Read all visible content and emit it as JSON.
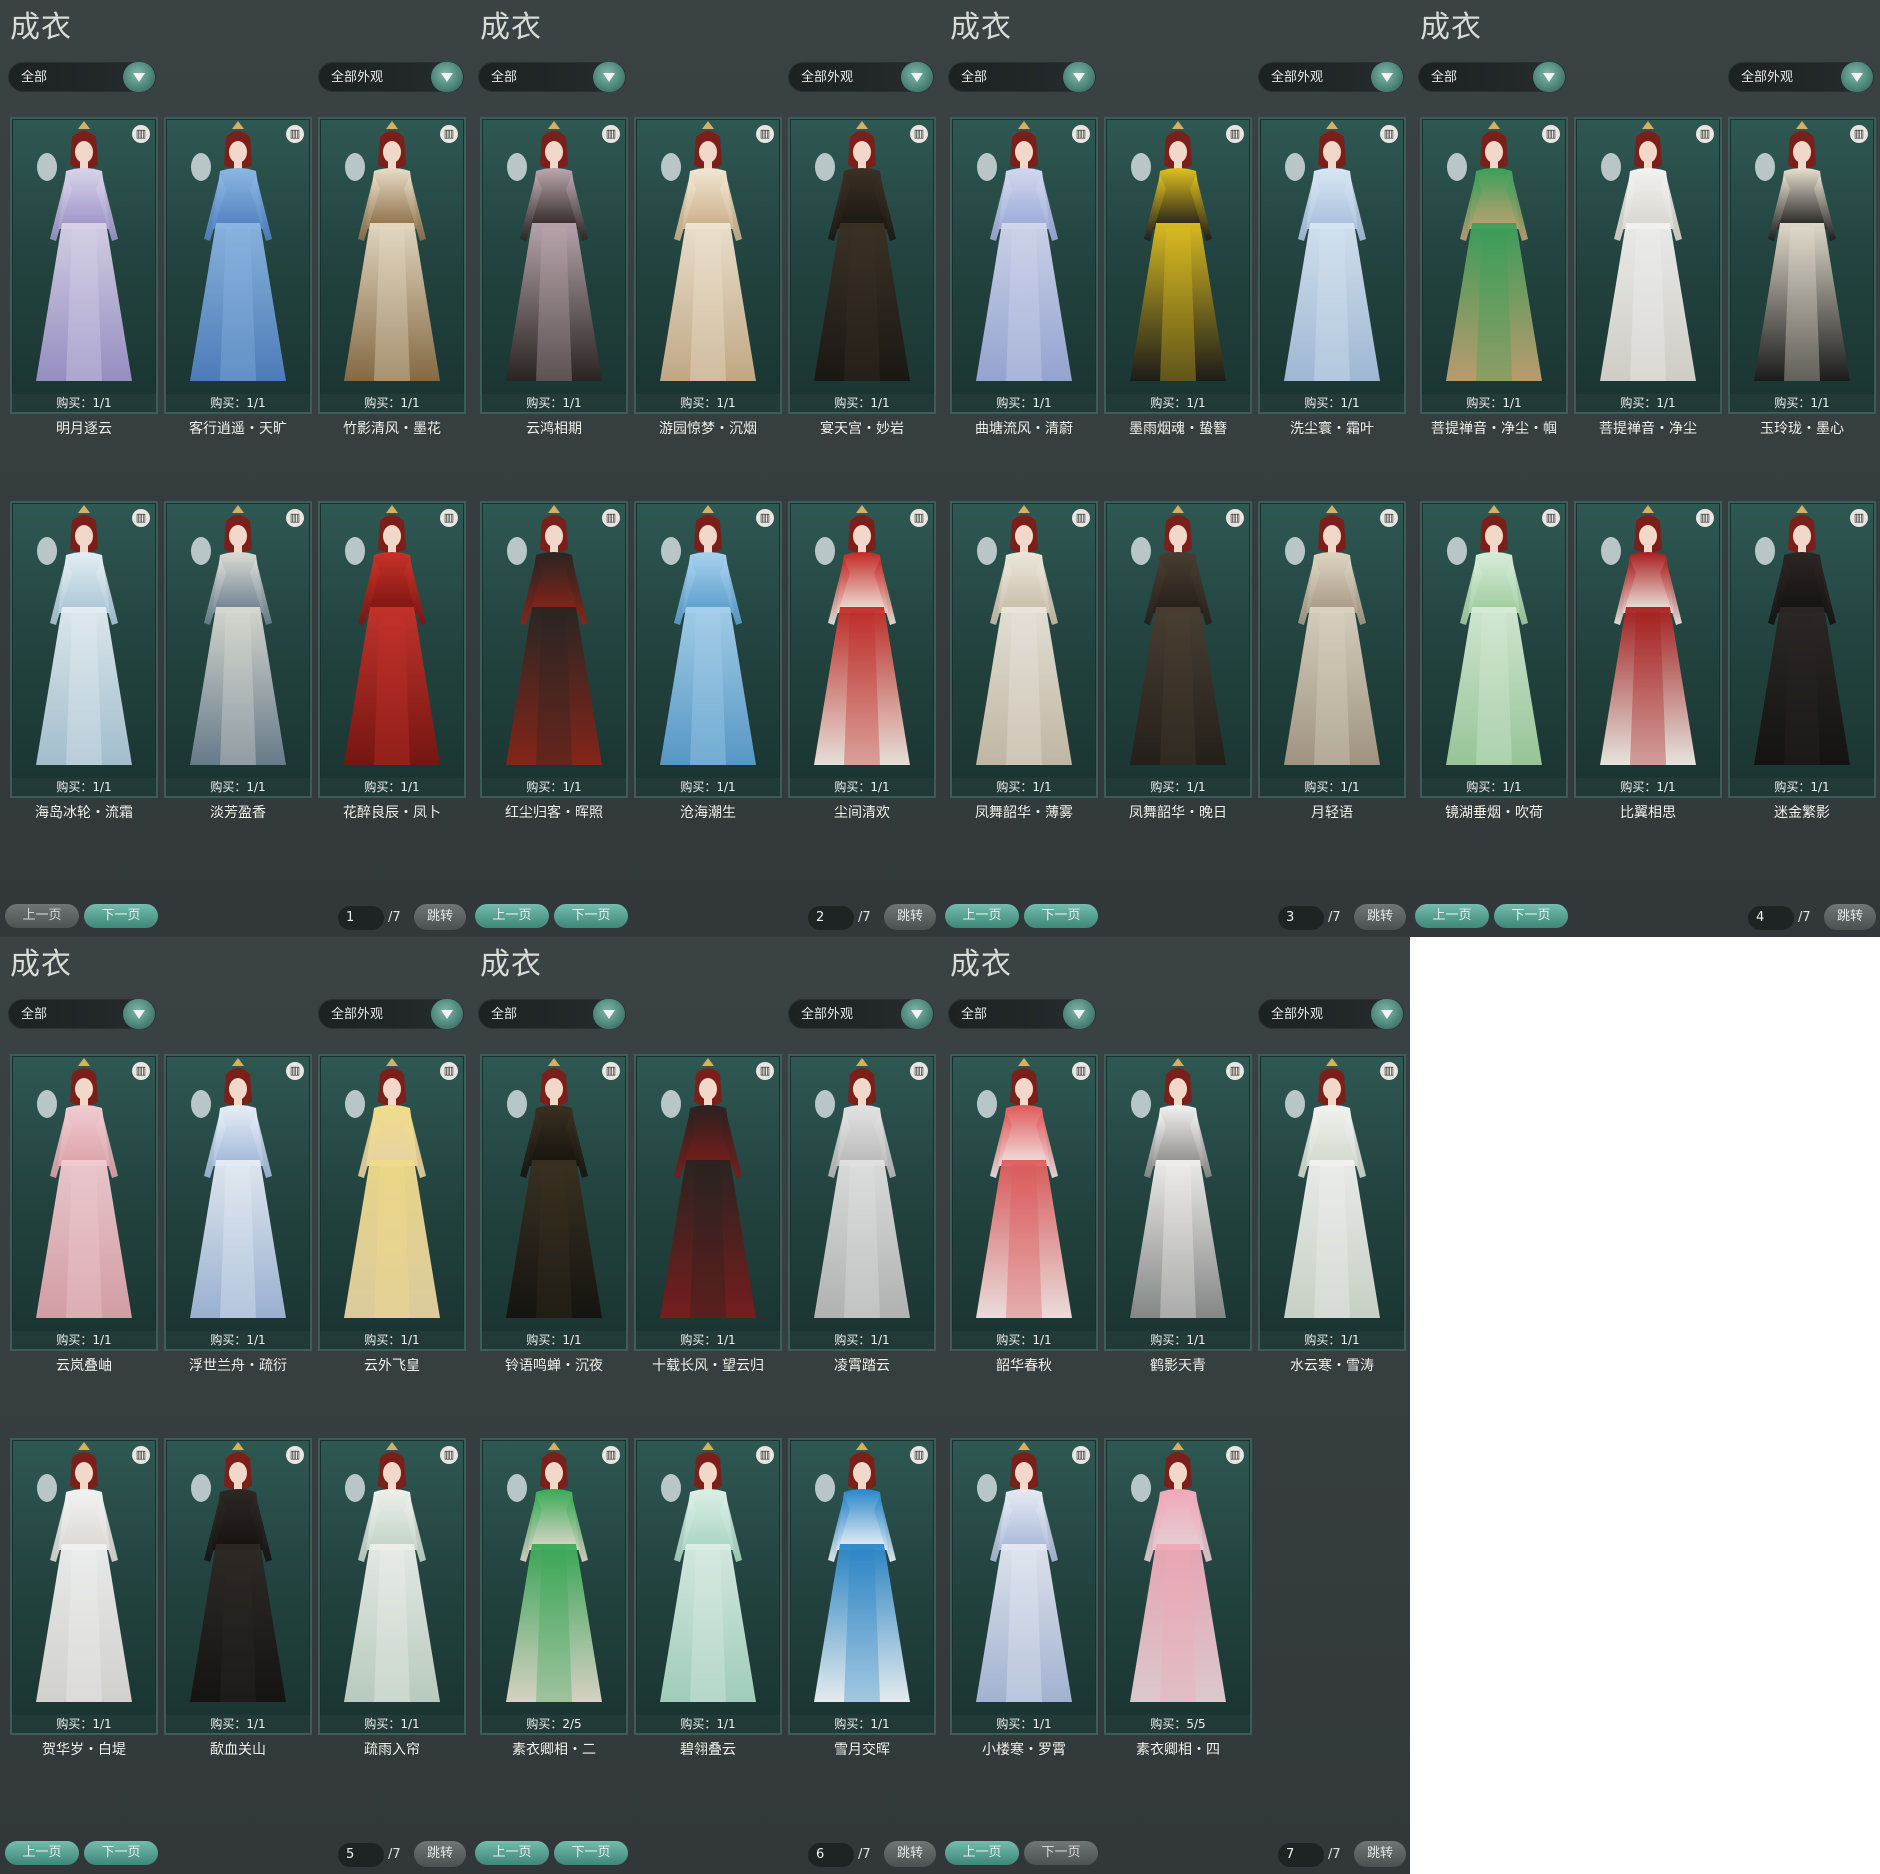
{
  "panels": [
    {
      "title": "成衣",
      "filter1": "全部",
      "filter2": "全部外观",
      "page": "1",
      "total": "/7",
      "prev": "上一页",
      "next": "下一页",
      "jump": "跳转",
      "prev_on": false,
      "next_on": true,
      "items": [
        {
          "buy": "购买：1/1",
          "name": "明月逐云",
          "palette": [
            "#d9d4ea",
            "#9c92c8"
          ]
        },
        {
          "buy": "购买：1/1",
          "name": "客行逍遥・天旷",
          "palette": [
            "#8db7e3",
            "#4f7fbf"
          ]
        },
        {
          "buy": "购买：1/1",
          "name": "竹影清风・墨花",
          "palette": [
            "#e8dcc6",
            "#8a6c44"
          ]
        },
        {
          "buy": "购买：1/1",
          "name": "海岛冰轮・流霜",
          "palette": [
            "#e4eef4",
            "#a9c4d4"
          ]
        },
        {
          "buy": "购买：1/1",
          "name": "淡芳盈香",
          "palette": [
            "#dcdcd4",
            "#6a7e8e"
          ]
        },
        {
          "buy": "购买：1/1",
          "name": "花醉良辰・凤卜",
          "palette": [
            "#c8322a",
            "#7a1410"
          ]
        }
      ]
    },
    {
      "title": "成衣",
      "filter1": "全部",
      "filter2": "全部外观",
      "page": "2",
      "total": "/7",
      "prev": "上一页",
      "next": "下一页",
      "jump": "跳转",
      "prev_on": true,
      "next_on": true,
      "items": [
        {
          "buy": "购买：1/1",
          "name": "云鸿相期",
          "palette": [
            "#bca8b0",
            "#2a2320"
          ]
        },
        {
          "buy": "购买：1/1",
          "name": "游园惊梦・沉烟",
          "palette": [
            "#f2e6d2",
            "#c9ad88"
          ]
        },
        {
          "buy": "购买：1/1",
          "name": "宴天宫・妙岩",
          "palette": [
            "#3c3024",
            "#1a1612"
          ]
        },
        {
          "buy": "购买：1/1",
          "name": "红尘归客・晖照",
          "palette": [
            "#2a2422",
            "#8a2418"
          ]
        },
        {
          "buy": "购买：1/1",
          "name": "沧海潮生",
          "palette": [
            "#a8d2ee",
            "#5a9ccc"
          ]
        },
        {
          "buy": "购买：1/1",
          "name": "尘间清欢",
          "palette": [
            "#c42a26",
            "#f0e8e0"
          ]
        }
      ]
    },
    {
      "title": "成衣",
      "filter1": "全部",
      "filter2": "全部外观",
      "page": "3",
      "total": "/7",
      "prev": "上一页",
      "next": "下一页",
      "jump": "跳转",
      "prev_on": true,
      "next_on": true,
      "items": [
        {
          "buy": "购买：1/1",
          "name": "曲塘流风・清蔚",
          "palette": [
            "#d2d8ee",
            "#9aa8d8"
          ]
        },
        {
          "buy": "购买：1/1",
          "name": "墨雨烟魂・蛰簪",
          "palette": [
            "#e0c020",
            "#1c1a18"
          ]
        },
        {
          "buy": "购买：1/1",
          "name": "洗尘寰・霜叶",
          "palette": [
            "#d8e6f4",
            "#a6bedc"
          ]
        },
        {
          "buy": "购买：1/1",
          "name": "凤舞韶华・薄雾",
          "palette": [
            "#ece6dc",
            "#c8bca8"
          ]
        },
        {
          "buy": "购买：1/1",
          "name": "凤舞韶华・晚日",
          "palette": [
            "#4a3e32",
            "#241e18"
          ]
        },
        {
          "buy": "购买：1/1",
          "name": "月轻语",
          "palette": [
            "#ddd4c2",
            "#a69884"
          ]
        }
      ]
    },
    {
      "title": "成衣",
      "filter1": "全部",
      "filter2": "全部外观",
      "page": "4",
      "total": "/7",
      "prev": "上一页",
      "next": "下一页",
      "jump": "跳转",
      "prev_on": true,
      "next_on": true,
      "items": [
        {
          "buy": "购买：1/1",
          "name": "菩提禅音・净尘・帼",
          "palette": [
            "#3aa05a",
            "#c2a070"
          ]
        },
        {
          "buy": "购买：1/1",
          "name": "菩提禅音・净尘",
          "palette": [
            "#f2f2f0",
            "#d8d4cc"
          ]
        },
        {
          "buy": "购买：1/1",
          "name": "玉玲珑・墨心",
          "palette": [
            "#e8e0d0",
            "#1a1a1a"
          ]
        },
        {
          "buy": "购买：1/1",
          "name": "镜湖垂烟・吹荷",
          "palette": [
            "#d8ecd8",
            "#9ccc9c"
          ]
        },
        {
          "buy": "购买：1/1",
          "name": "比翼相思",
          "palette": [
            "#a81e1e",
            "#f0ece6"
          ]
        },
        {
          "buy": "购买：1/1",
          "name": "迷金繁影",
          "palette": [
            "#2c2624",
            "#14110f"
          ]
        }
      ]
    },
    {
      "title": "成衣",
      "filter1": "全部",
      "filter2": "全部外观",
      "page": "5",
      "total": "/7",
      "prev": "上一页",
      "next": "下一页",
      "jump": "跳转",
      "prev_on": true,
      "next_on": true,
      "items": [
        {
          "buy": "购买：1/1",
          "name": "云岚叠岫",
          "palette": [
            "#f0ccd0",
            "#dca2aa"
          ]
        },
        {
          "buy": "购买：1/1",
          "name": "浮世兰舟・疏衍",
          "palette": [
            "#e8eef6",
            "#9fb6d8"
          ]
        },
        {
          "buy": "购买：1/1",
          "name": "云外飞皇",
          "palette": [
            "#f0dc8a",
            "#e6d2a2"
          ]
        },
        {
          "buy": "购买：1/1",
          "name": "贺华岁・白堤",
          "palette": [
            "#f2f2f2",
            "#dad8d4"
          ]
        },
        {
          "buy": "购买：1/1",
          "name": "歃血关山",
          "palette": [
            "#2e2824",
            "#151210"
          ]
        },
        {
          "buy": "购买：1/1",
          "name": "疏雨入帘",
          "palette": [
            "#eef0ec",
            "#bfd2c4"
          ]
        }
      ]
    },
    {
      "title": "成衣",
      "filter1": "全部",
      "filter2": "全部外观",
      "page": "6",
      "total": "/7",
      "prev": "上一页",
      "next": "下一页",
      "jump": "跳转",
      "prev_on": true,
      "next_on": true,
      "items": [
        {
          "buy": "购买：1/1",
          "name": "铃语鸣蝉・沉夜",
          "palette": [
            "#3a3020",
            "#15120e"
          ]
        },
        {
          "buy": "购买：1/1",
          "name": "十载长风・望云归",
          "palette": [
            "#2a2220",
            "#7a1c1c"
          ]
        },
        {
          "buy": "购买：1/1",
          "name": "凌霄踏云",
          "palette": [
            "#e2e2e2",
            "#b8b8b8"
          ]
        },
        {
          "buy": "购买：2/5",
          "name": "素衣卿相・二",
          "palette": [
            "#3aaa56",
            "#e0d8cc"
          ]
        },
        {
          "buy": "购买：1/1",
          "name": "碧翎叠云",
          "palette": [
            "#dcefe6",
            "#a6d4c0"
          ]
        },
        {
          "buy": "购买：1/1",
          "name": "雪月交晖",
          "palette": [
            "#2a86c8",
            "#eef4f8"
          ]
        }
      ]
    },
    {
      "title": "成衣",
      "filter1": "全部",
      "filter2": "全部外观",
      "page": "7",
      "total": "/7",
      "prev": "上一页",
      "next": "下一页",
      "jump": "跳转",
      "prev_on": true,
      "next_on": false,
      "items": [
        {
          "buy": "购买：1/1",
          "name": "韶华春秋",
          "palette": [
            "#e05a5a",
            "#f4e4e4"
          ]
        },
        {
          "buy": "购买：1/1",
          "name": "鹤影天青",
          "palette": [
            "#f4f2f0",
            "#8a8a8a"
          ]
        },
        {
          "buy": "购买：1/1",
          "name": "水云寒・雪涛",
          "palette": [
            "#f2f2f0",
            "#d0d8cc"
          ]
        },
        {
          "buy": "购买：1/1",
          "name": "小楼寒・罗霄",
          "palette": [
            "#e6eaf4",
            "#a8b8d8"
          ]
        },
        {
          "buy": "购买：5/5",
          "name": "素衣卿相・四",
          "palette": [
            "#f0a8b8",
            "#e4d0d4"
          ]
        }
      ]
    }
  ]
}
